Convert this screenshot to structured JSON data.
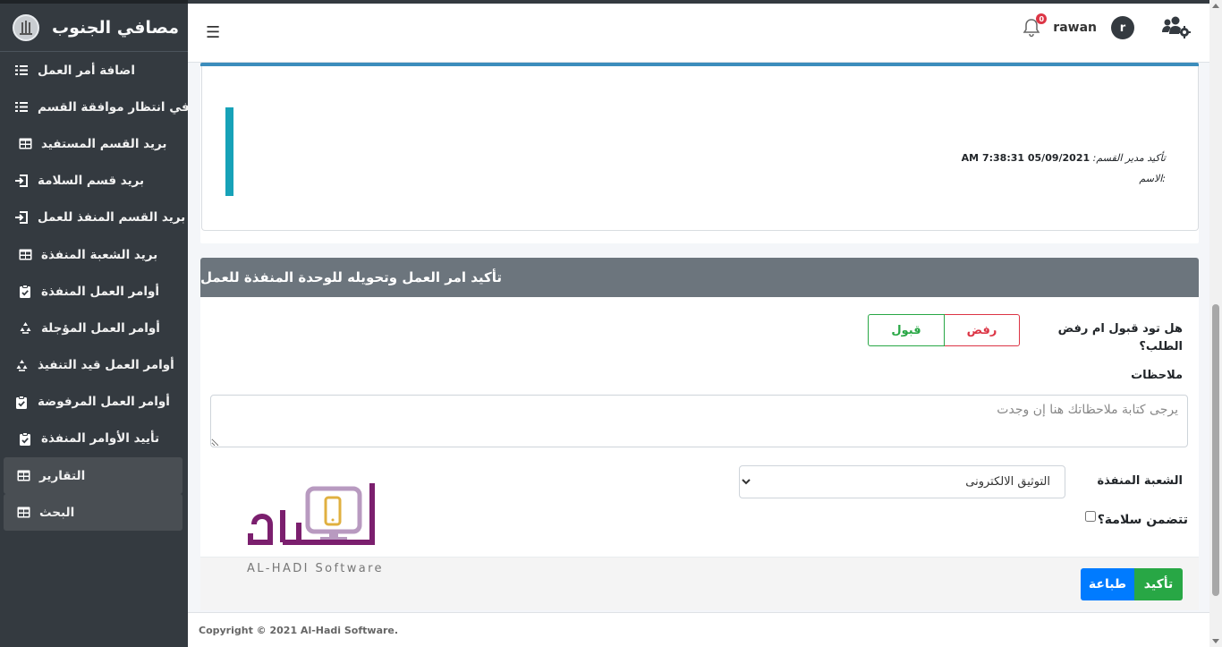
{
  "brand": {
    "title": "مصافي الجنوب"
  },
  "sidebar": {
    "items": [
      {
        "label": "اضافة أمر العمل",
        "icon": "task-list-icon"
      },
      {
        "label": "أوامر في انتظار موافقة القسم",
        "icon": "task-list-icon"
      },
      {
        "label": "بريد القسم المستفيد",
        "icon": "table-icon"
      },
      {
        "label": "بريد قسم السلامة",
        "icon": "sign-in-icon"
      },
      {
        "label": "بريد القسم المنفذ للعمل",
        "icon": "sign-in-icon"
      },
      {
        "label": "بريد الشعبة المنفذة",
        "icon": "table-icon"
      },
      {
        "label": "أوامر العمل المنفذة",
        "icon": "clipboard-check-icon"
      },
      {
        "label": "أوامر العمل المؤجلة",
        "icon": "recycle-icon"
      },
      {
        "label": "أوامر العمل قيد التنفيذ",
        "icon": "recycle-icon"
      },
      {
        "label": "أوامر العمل المرفوضة",
        "icon": "clipboard-check-icon"
      },
      {
        "label": "تأييد الأوامر المنفذة",
        "icon": "clipboard-check-icon"
      },
      {
        "label": "التقارير",
        "icon": "table-icon"
      },
      {
        "label": "البحث",
        "icon": "table-icon"
      }
    ]
  },
  "header": {
    "username": "rawan",
    "avatar_letter": "r",
    "notification_count": "0"
  },
  "card1": {
    "confirm_label": "تأكيد مدير القسم:",
    "confirm_value": "05/09/2021 7:38:31 AM",
    "name_label": ":الاسم"
  },
  "card2": {
    "title": "تأكيد امر العمل وتحويله للوحدة المنفذة للعمل",
    "question": "هل تود قبول ام رفض الطلب؟",
    "accept_label": "قبول",
    "reject_label": "رفض",
    "notes_label": "ملاحظات",
    "notes_placeholder": "يرجى كتابة ملاحظاتك هنا إن وجدت",
    "unit_label": "الشعبة المنفذة",
    "unit_selected": "التوثيق الالكترونى",
    "safety_label": "تتضمن سلامة؟",
    "print_label": "طباعة",
    "confirm_label": "تأكيد"
  },
  "watermark": {
    "text": "AL-HADI Software"
  },
  "footer": {
    "copyright": "Copyright © 2021 Al-Hadi Software."
  },
  "colors": {
    "sidebar_bg": "#343a40",
    "card_header_bg": "#6c757d",
    "accent_blue": "#3c8dbc",
    "info_bar": "#17a2b8",
    "success": "#28a745",
    "danger": "#dc3545",
    "primary": "#007bff",
    "watermark_purple": "#7b1f6e"
  }
}
